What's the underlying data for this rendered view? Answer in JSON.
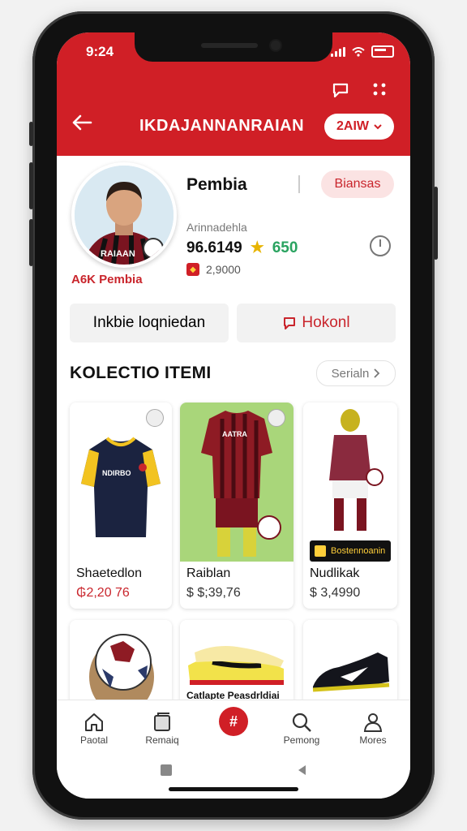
{
  "status_bar": {
    "time": "9:24"
  },
  "header": {
    "title": "IKDAJANNANRAIAN",
    "language_label": "2AIW",
    "icons": [
      "back-arrow-icon",
      "chat-icon",
      "more-icon"
    ]
  },
  "profile": {
    "name": "Pembia",
    "status_pill": "Biansas",
    "subtitle": "Arinnadehla",
    "score": "96.6149",
    "rating": "650",
    "badge_text": "2,9000",
    "player_name": "A6K Pembia"
  },
  "actions": {
    "primary": "Inkbie loqniedan",
    "secondary": "Hokonl"
  },
  "collection": {
    "title": "KOLECTIO ITEMI",
    "see_all": "Serialn",
    "items": [
      {
        "name": "Shaetedlon",
        "price": "₲2,20 76"
      },
      {
        "name": "Raiblan",
        "price": "$ $;39,76"
      },
      {
        "name": "Nudlikak",
        "price": "$ 3,4990",
        "tag": "Bostennoanin"
      },
      {
        "name": "",
        "price": ""
      },
      {
        "name": "Catlapte Peasdrldiai",
        "price": ""
      },
      {
        "name": "",
        "price": ""
      }
    ]
  },
  "bottom_nav": {
    "items": [
      {
        "label": "Paotal",
        "icon": "home-icon"
      },
      {
        "label": "Remaiq",
        "icon": "cards-icon"
      },
      {
        "label": "",
        "icon": "add-icon"
      },
      {
        "label": "Pemong",
        "icon": "search-icon"
      },
      {
        "label": "Mores",
        "icon": "profile-icon"
      }
    ]
  },
  "colors": {
    "brand": "#d01f26",
    "accent_green": "#2aa360",
    "star": "#e8b400"
  }
}
